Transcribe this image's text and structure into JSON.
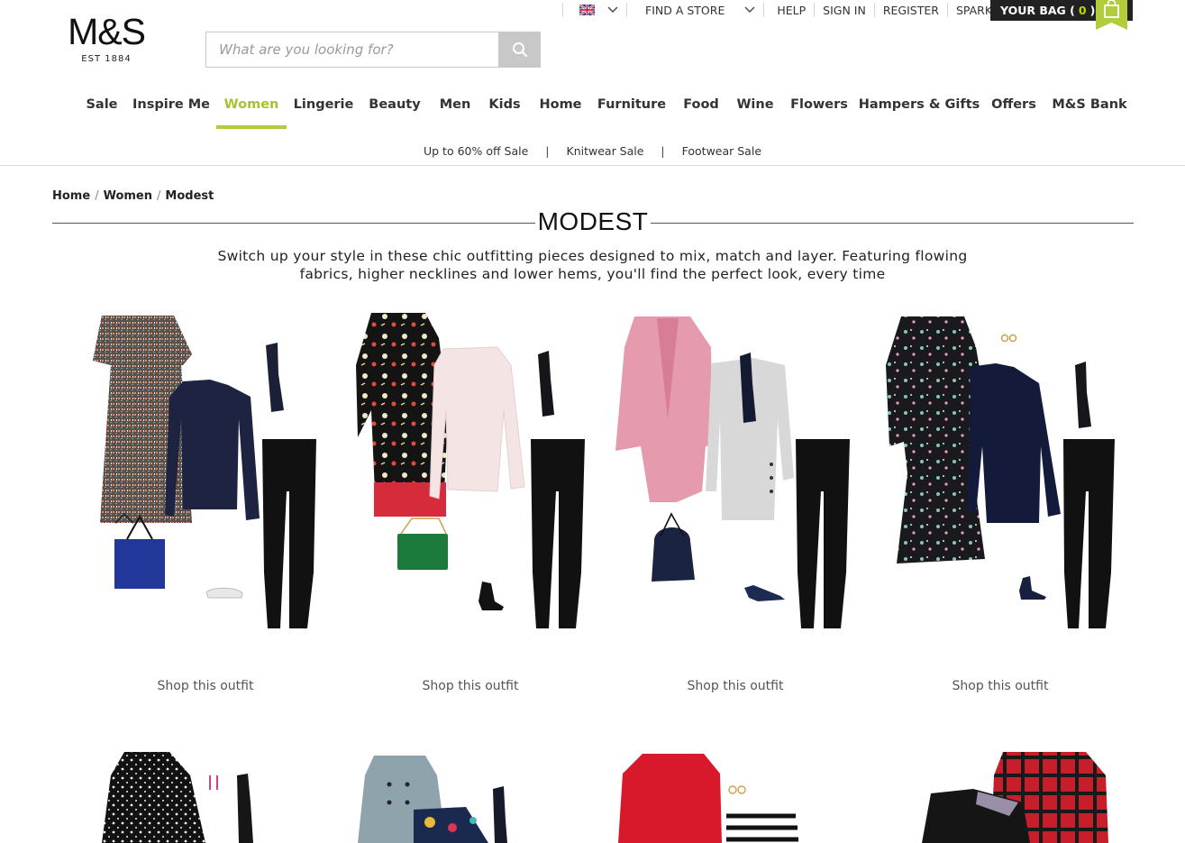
{
  "brand": {
    "name": "M&S",
    "tagline": "EST 1884"
  },
  "search": {
    "placeholder": "What are you looking for?"
  },
  "utility": {
    "find_store": "FIND A STORE",
    "help": "HELP",
    "sign_in": "SIGN IN",
    "register": "REGISTER",
    "sparks": "SPARKS"
  },
  "bag": {
    "label": "YOUR BAG (",
    "count": "0",
    "close": ")"
  },
  "nav": {
    "items": [
      {
        "label": "Sale"
      },
      {
        "label": "Inspire Me"
      },
      {
        "label": "Women"
      },
      {
        "label": "Lingerie"
      },
      {
        "label": "Beauty"
      },
      {
        "label": "Men"
      },
      {
        "label": "Kids"
      },
      {
        "label": "Home"
      },
      {
        "label": "Furniture"
      },
      {
        "label": "Food"
      },
      {
        "label": "Wine"
      },
      {
        "label": "Flowers"
      },
      {
        "label": "Hampers & Gifts"
      },
      {
        "label": "Offers"
      },
      {
        "label": "M&S Bank"
      }
    ],
    "active_index": 2
  },
  "subnav": {
    "items": [
      "Up to 60% off Sale",
      "Knitwear Sale",
      "Footwear Sale"
    ],
    "separator": "|"
  },
  "breadcrumb": {
    "items": [
      "Home",
      "Women",
      "Modest"
    ],
    "separator": "/"
  },
  "page": {
    "title": "MODEST",
    "intro_line1": "Switch up your style in these chic outfitting pieces designed to mix, match and layer. Featuring flowing",
    "intro_line2": "fabrics, higher necklines and lower hems, you'll find the perfect look, every time"
  },
  "outfits": {
    "shop_label": "Shop this outfit",
    "items": [
      {
        "main": "tweed-dress",
        "top": "navy-jumper",
        "bag": "blue-tote",
        "shoe": "silver-flat"
      },
      {
        "main": "floral-dress",
        "top": "pale-pink-jumper",
        "bag": "green-handbag",
        "shoe": "black-boot"
      },
      {
        "main": "pink-coat",
        "top": "grey-knit-dress",
        "bag": "navy-bucket-bag",
        "shoe": "navy-court"
      },
      {
        "main": "print-midi-dress",
        "top": "navy-cardigan",
        "bag": "earrings",
        "shoe": "navy-boot"
      }
    ]
  },
  "colors": {
    "accent": "#b2cd3c",
    "bag_bg": "#222222",
    "nav_text": "#333333",
    "search_btn": "#c8c8c8"
  }
}
